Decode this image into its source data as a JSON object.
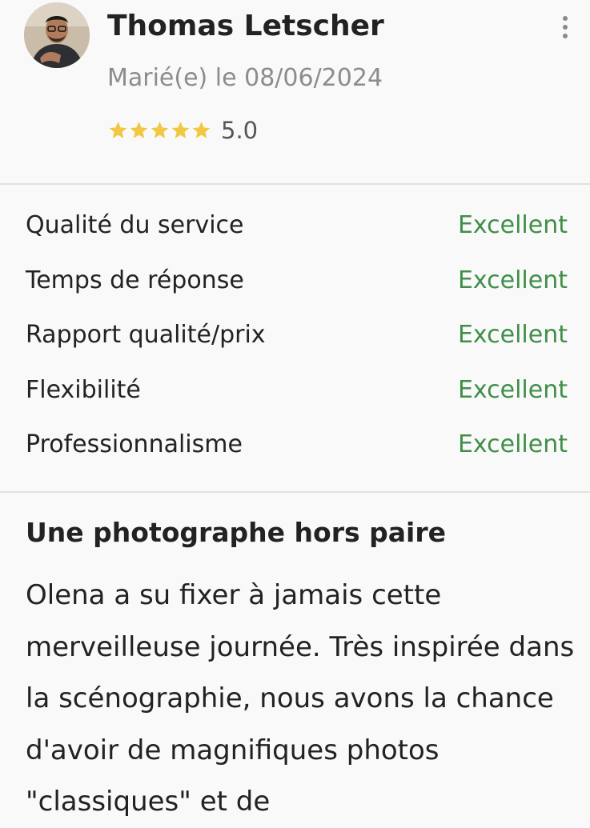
{
  "reviewer": {
    "name": "Thomas Letscher",
    "married_date": "Marié(e) le 08/06/2024",
    "avatar_icon": "reviewer-avatar-photo"
  },
  "rating": {
    "stars": 5,
    "max_stars": 5,
    "value": "5.0",
    "star_color": "#f2c744"
  },
  "menu_icon": "more-vertical-icon",
  "criteria": [
    {
      "label": "Qualité du service",
      "value": "Excellent"
    },
    {
      "label": "Temps de réponse",
      "value": "Excellent"
    },
    {
      "label": "Rapport qualité/prix",
      "value": "Excellent"
    },
    {
      "label": "Flexibilité",
      "value": "Excellent"
    },
    {
      "label": "Professionnalisme",
      "value": "Excellent"
    }
  ],
  "review": {
    "title": "Une photographe hors paire",
    "body": "Olena a su fixer à jamais cette merveilleuse journée. Très inspirée dans la scénographie, nous avons la chance d'avoir de magnifiques photos \"classiques\" et de"
  },
  "colors": {
    "accent_green": "#3f8f48",
    "muted_text": "#8c8c8c",
    "background": "#f9f9f9"
  }
}
